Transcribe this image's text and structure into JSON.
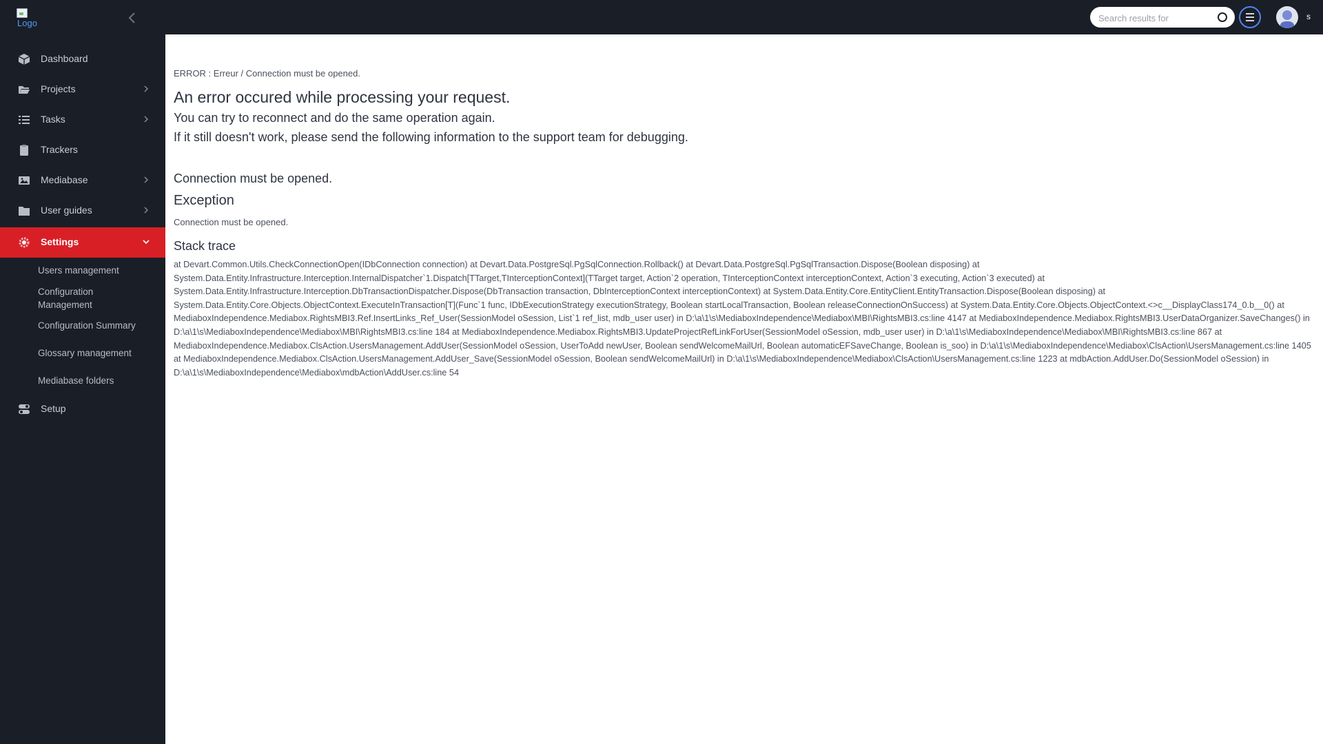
{
  "header": {
    "logo_text": "Logo",
    "search_placeholder": "Search results for",
    "user_initial": "s"
  },
  "sidebar": {
    "items": [
      {
        "label": "Dashboard",
        "icon": "cube-icon",
        "has_chevron": false
      },
      {
        "label": "Projects",
        "icon": "folder-open-icon",
        "has_chevron": true
      },
      {
        "label": "Tasks",
        "icon": "list-icon",
        "has_chevron": true
      },
      {
        "label": "Trackers",
        "icon": "clipboard-icon",
        "has_chevron": false
      },
      {
        "label": "Mediabase",
        "icon": "image-icon",
        "has_chevron": true
      },
      {
        "label": "User guides",
        "icon": "folder-icon",
        "has_chevron": true
      },
      {
        "label": "Settings",
        "icon": "gear-icon",
        "has_chevron": true,
        "active": true,
        "expanded": true
      },
      {
        "label": "Setup",
        "icon": "toggle-icon",
        "has_chevron": false
      }
    ],
    "settings_subitems": [
      "Users management",
      "Configuration Management",
      "Configuration Summary",
      "Glossary management",
      "Mediabase folders"
    ]
  },
  "main": {
    "breadcrumb": "ERROR : Erreur / Connection must be opened.",
    "title": "An error occured while processing your request.",
    "line1": "You can try to reconnect and do the same operation again.",
    "line2": "If it still doesn't work, please send the following information to the support team for debugging.",
    "message": "Connection must be opened.",
    "exception_heading": "Exception",
    "exception_text": "Connection must be opened.",
    "stack_heading": "Stack trace",
    "stack_trace": "at Devart.Common.Utils.CheckConnectionOpen(IDbConnection connection) at Devart.Data.PostgreSql.PgSqlConnection.Rollback() at Devart.Data.PostgreSql.PgSqlTransaction.Dispose(Boolean disposing) at System.Data.Entity.Infrastructure.Interception.InternalDispatcher`1.Dispatch[TTarget,TInterceptionContext](TTarget target, Action`2 operation, TInterceptionContext interceptionContext, Action`3 executing, Action`3 executed) at System.Data.Entity.Infrastructure.Interception.DbTransactionDispatcher.Dispose(DbTransaction transaction, DbInterceptionContext interceptionContext) at System.Data.Entity.Core.EntityClient.EntityTransaction.Dispose(Boolean disposing) at System.Data.Entity.Core.Objects.ObjectContext.ExecuteInTransaction[T](Func`1 func, IDbExecutionStrategy executionStrategy, Boolean startLocalTransaction, Boolean releaseConnectionOnSuccess) at System.Data.Entity.Core.Objects.ObjectContext.<>c__DisplayClass174_0.b__0() at MediaboxIndependence.Mediabox.RightsMBI3.Ref.InsertLinks_Ref_User(SessionModel oSession, List`1 ref_list, mdb_user user) in D:\\a\\1\\s\\MediaboxIndependence\\Mediabox\\MBI\\RightsMBI3.cs:line 4147 at MediaboxIndependence.Mediabox.RightsMBI3.UserDataOrganizer.SaveChanges() in D:\\a\\1\\s\\MediaboxIndependence\\Mediabox\\MBI\\RightsMBI3.cs:line 184 at MediaboxIndependence.Mediabox.RightsMBI3.UpdateProjectRefLinkForUser(SessionModel oSession, mdb_user user) in D:\\a\\1\\s\\MediaboxIndependence\\Mediabox\\MBI\\RightsMBI3.cs:line 867 at MediaboxIndependence.Mediabox.ClsAction.UsersManagement.AddUser(SessionModel oSession, UserToAdd newUser, Boolean sendWelcomeMailUrl, Boolean automaticEFSaveChange, Boolean is_soo) in D:\\a\\1\\s\\MediaboxIndependence\\Mediabox\\ClsAction\\UsersManagement.cs:line 1405 at MediaboxIndependence.Mediabox.ClsAction.UsersManagement.AddUser_Save(SessionModel oSession, Boolean sendWelcomeMailUrl) in D:\\a\\1\\s\\MediaboxIndependence\\Mediabox\\ClsAction\\UsersManagement.cs:line 1223 at mdbAction.AddUser.Do(SessionModel oSession) in D:\\a\\1\\s\\MediaboxIndependence\\Mediabox\\mdbAction\\AddUser.cs:line 54"
  },
  "colors": {
    "sidebar_bg": "#1a1e26",
    "active_item": "#d81f26",
    "text_dark": "#2f3441"
  }
}
